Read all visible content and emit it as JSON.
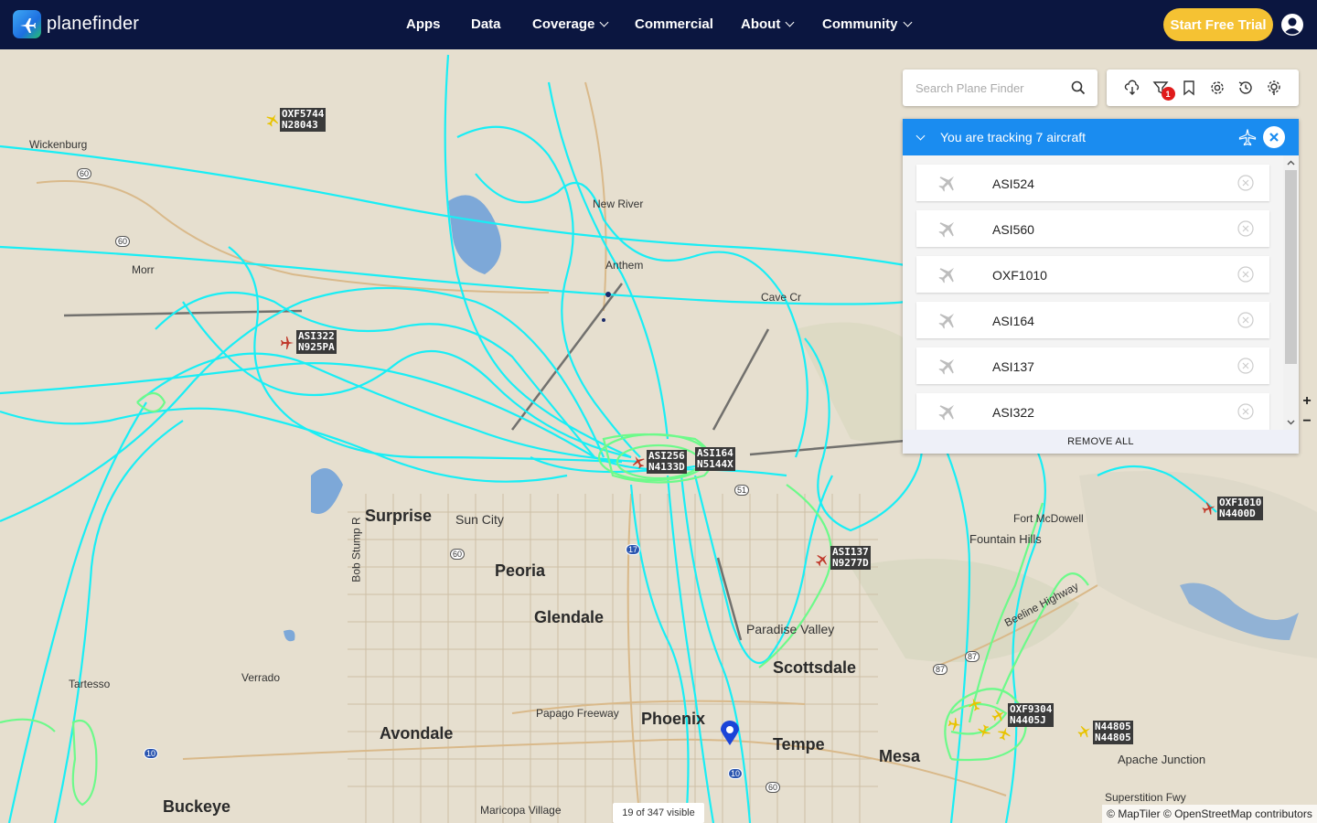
{
  "header": {
    "logo_text_bold": "plane",
    "logo_text_rest": "finder",
    "nav": [
      "Apps",
      "Data",
      "Coverage",
      "Commercial",
      "About",
      "Community"
    ],
    "trial_label": "Start Free Trial"
  },
  "search": {
    "placeholder": "Search Plane Finder"
  },
  "toolbar": {
    "badge": "1",
    "icons": [
      "weather-icon",
      "filter-icon",
      "bookmark-icon",
      "settings-icon",
      "history-icon",
      "weather-settings-icon"
    ]
  },
  "tracking": {
    "title": "You are tracking 7 aircraft",
    "items": [
      "ASI524",
      "ASI560",
      "OXF1010",
      "ASI164",
      "ASI137",
      "ASI322"
    ],
    "remove_all": "REMOVE ALL"
  },
  "zoom": {
    "in": "+",
    "out": "−"
  },
  "status": {
    "visible": "19 of 347 visible",
    "attribution": "© MapTiler © OpenStreetMap contributors"
  },
  "map": {
    "cities": {
      "wickenburg": "Wickenburg",
      "new_river": "New River",
      "anthem": "Anthem",
      "morristown": "Morr",
      "cave_creek": "Cave Cr",
      "surprise": "Surprise",
      "sun_city": "Sun City",
      "peoria": "Peoria",
      "glendale": "Glendale",
      "phoenix": "Phoenix",
      "scottsdale": "Scottsdale",
      "paradise_valley": "Paradise Valley",
      "tempe": "Tempe",
      "mesa": "Mesa",
      "avondale": "Avondale",
      "buckeye": "Buckeye",
      "verrado": "Verrado",
      "tartesso": "Tartesso",
      "fountain_hills": "Fountain Hills",
      "fort_mcdowell": "Fort McDowell",
      "apache_junction": "Apache Junction",
      "maricopa_village": "Maricopa Village",
      "papago_freeway": "Papago Freeway",
      "superstition_fwy": "Superstition Fwy",
      "beeline_highway": "Beeline Highway",
      "bob_stump": "Bob Stump R"
    },
    "planes": [
      {
        "cs": "OXF5744",
        "reg": "N28043"
      },
      {
        "cs": "ASI322",
        "reg": "N925PA"
      },
      {
        "cs": "ASI256",
        "reg": "N4133D"
      },
      {
        "cs": "ASI164",
        "reg": "N5144X"
      },
      {
        "cs": "ASI137",
        "reg": "N9277D"
      },
      {
        "cs": "OXF1010",
        "reg": "N4400D"
      },
      {
        "cs": "OXF9304",
        "reg": "N4405J"
      },
      {
        "cs": "N44805",
        "reg": "N44805"
      }
    ],
    "routes": [
      "60",
      "60",
      "60",
      "51",
      "17",
      "87",
      "87",
      "10",
      "10",
      "60"
    ]
  },
  "colors": {
    "header": "#0b1640",
    "accent": "#1a8cf0",
    "trial": "#f5c233",
    "track_cyan": "#19eef5",
    "track_green": "#6dfa8a",
    "plane_red": "#c0392b",
    "plane_yellow": "#e8c300"
  }
}
